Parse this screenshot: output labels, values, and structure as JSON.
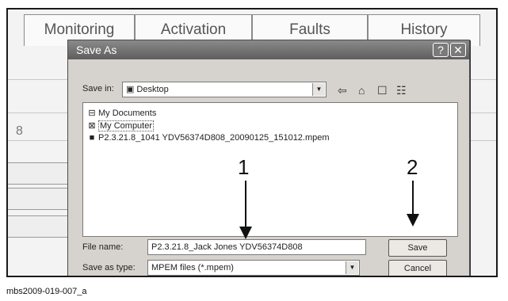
{
  "background": {
    "tabs": [
      "Monitoring",
      "Activation",
      "Faults",
      "History"
    ],
    "left_value": "8"
  },
  "dialog": {
    "title": "Save As",
    "help_button": "?",
    "close_button": "✕",
    "save_in_label": "Save in:",
    "save_in_value": "Desktop",
    "items": [
      {
        "label": "My Documents",
        "icon": "folder-icon"
      },
      {
        "label": "My Computer",
        "icon": "computer-icon"
      },
      {
        "label": "P2.3.21.8_1041 YDV56374D808_20090125_151012.mpem",
        "icon": "file-icon"
      }
    ],
    "filename_label": "File name:",
    "filename_value": "P2.3.21.8_Jack Jones YDV56374D808",
    "type_label": "Save as type:",
    "type_value": "MPEM files (*.mpem)",
    "save_button": "Save",
    "cancel_button": "Cancel"
  },
  "callouts": {
    "one": "1",
    "two": "2"
  },
  "caption": "mbs2009-019-007_a"
}
